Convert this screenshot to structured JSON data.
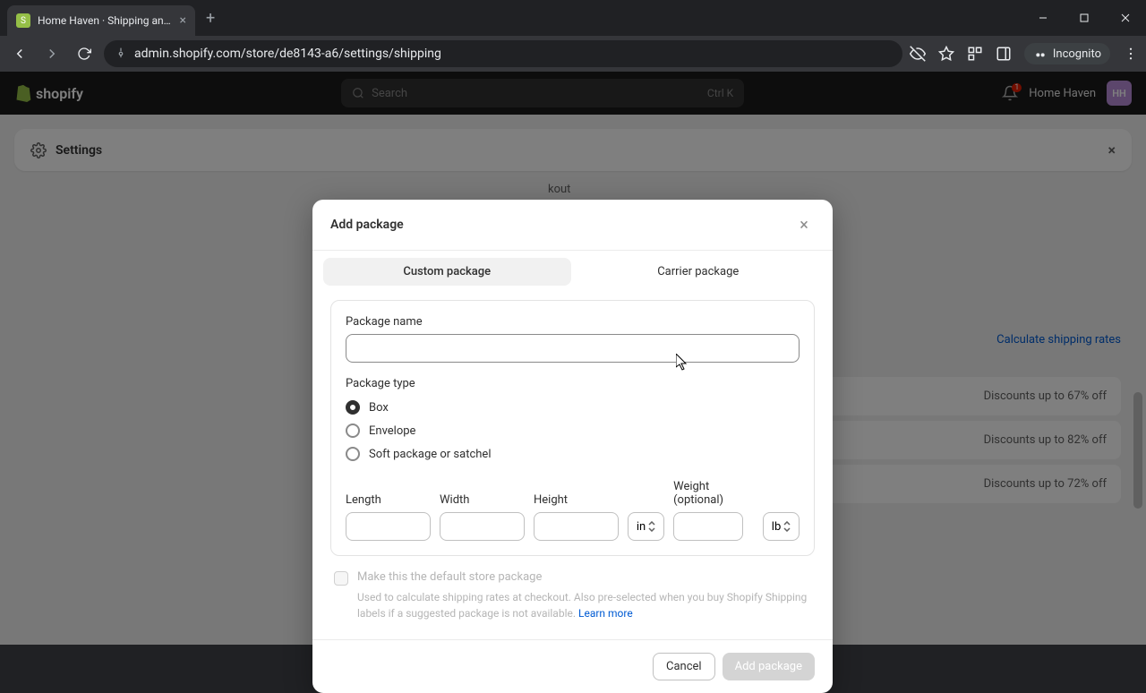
{
  "browser": {
    "tab_title": "Home Haven · Shipping and de",
    "url": "admin.shopify.com/store/de8143-a6/settings/shipping",
    "incognito_label": "Incognito"
  },
  "header": {
    "logo_text": "shopify",
    "search_placeholder": "Search",
    "search_shortcut": "Ctrl K",
    "notification_count": "1",
    "store_name": "Home Haven",
    "avatar_initials": "HH"
  },
  "settings_bar": {
    "title": "Settings"
  },
  "background": {
    "checkout_text": "kout",
    "rates_text": "e shipping rates",
    "calculate_link": "Calculate shipping rates",
    "discounts": [
      "Discounts up to 67% off",
      "Discounts up to 82% off",
      "Discounts up to 72% off"
    ]
  },
  "modal": {
    "title": "Add package",
    "tabs": {
      "custom": "Custom package",
      "carrier": "Carrier package"
    },
    "package_name_label": "Package name",
    "package_type_label": "Package type",
    "types": {
      "box": "Box",
      "envelope": "Envelope",
      "soft": "Soft package or satchel"
    },
    "dims": {
      "length": "Length",
      "width": "Width",
      "height": "Height",
      "length_unit": "in",
      "weight_label": "Weight (optional)",
      "weight_unit": "lb"
    },
    "default": {
      "label": "Make this the default store package",
      "help": "Used to calculate shipping rates at checkout. Also pre-selected when you buy Shopify Shipping labels if a suggested package is not available.",
      "learn_more": "Learn more"
    },
    "buttons": {
      "cancel": "Cancel",
      "submit": "Add package"
    }
  }
}
